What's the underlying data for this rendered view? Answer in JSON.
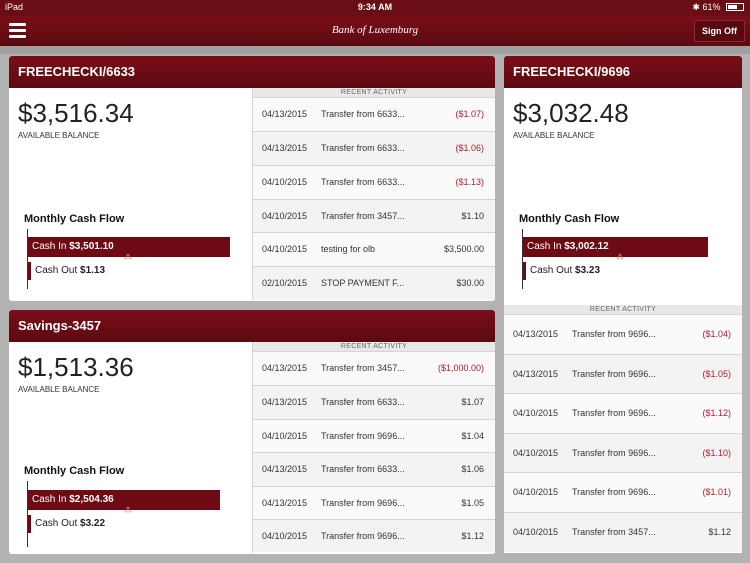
{
  "status": {
    "device": "iPad",
    "time": "9:34 AM",
    "battery": "61%"
  },
  "nav": {
    "brand": "Bank of Luxemburg",
    "signoff": "Sign Off"
  },
  "activity_header": "RECENT ACTIVITY",
  "accounts": [
    {
      "name": "FREECHECKI/6633",
      "balance": "$3,516.34",
      "balance_label": "AVAILABLE BALANCE",
      "cashflow_title": "Monthly Cash Flow",
      "cash_in_label": "Cash In",
      "cash_in": "$3,501.10",
      "cash_out_label": "Cash Out",
      "cash_out": "$1.13",
      "transactions": [
        {
          "date": "04/13/2015",
          "desc": "Transfer from 6633...",
          "amount": "($1.07)"
        },
        {
          "date": "04/13/2015",
          "desc": "Transfer from 6633...",
          "amount": "($1.06)"
        },
        {
          "date": "04/10/2015",
          "desc": "Transfer from 6633...",
          "amount": "($1.13)"
        },
        {
          "date": "04/10/2015",
          "desc": "Transfer from 3457...",
          "amount": "$1.10"
        },
        {
          "date": "04/10/2015",
          "desc": "testing for olb",
          "amount": "$3,500.00"
        },
        {
          "date": "02/10/2015",
          "desc": "STOP PAYMENT F...",
          "amount": "$30.00"
        }
      ]
    },
    {
      "name": "Savings-3457",
      "balance": "$1,513.36",
      "balance_label": "AVAILABLE BALANCE",
      "cashflow_title": "Monthly Cash Flow",
      "cash_in_label": "Cash In",
      "cash_in": "$2,504.36",
      "cash_out_label": "Cash Out",
      "cash_out": "$3.22",
      "transactions": [
        {
          "date": "04/13/2015",
          "desc": "Transfer from 3457...",
          "amount": "($1,000.00)"
        },
        {
          "date": "04/13/2015",
          "desc": "Transfer from 6633...",
          "amount": "$1.07"
        },
        {
          "date": "04/10/2015",
          "desc": "Transfer from 9696...",
          "amount": "$1.04"
        },
        {
          "date": "04/13/2015",
          "desc": "Transfer from 6633...",
          "amount": "$1.06"
        },
        {
          "date": "04/13/2015",
          "desc": "Transfer from 9696...",
          "amount": "$1.05"
        },
        {
          "date": "04/10/2015",
          "desc": "Transfer from 9696...",
          "amount": "$1.12"
        }
      ]
    },
    {
      "name": "FREECHECKI/9696",
      "balance": "$3,032.48",
      "balance_label": "AVAILABLE BALANCE",
      "cashflow_title": "Monthly Cash Flow",
      "cash_in_label": "Cash In",
      "cash_in": "$3,002.12",
      "cash_out_label": "Cash Out",
      "cash_out": "$3.23",
      "transactions": [
        {
          "date": "04/13/2015",
          "desc": "Transfer from 9696...",
          "amount": "($1.04)"
        },
        {
          "date": "04/13/2015",
          "desc": "Transfer from 9696...",
          "amount": "($1.05)"
        },
        {
          "date": "04/10/2015",
          "desc": "Transfer from 9696...",
          "amount": "($1.12)"
        },
        {
          "date": "04/10/2015",
          "desc": "Transfer from 9696...",
          "amount": "($1.10)"
        },
        {
          "date": "04/10/2015",
          "desc": "Transfer from 9696...",
          "amount": "($1.01)"
        },
        {
          "date": "04/10/2015",
          "desc": "Transfer from 3457...",
          "amount": "$1.12"
        }
      ]
    }
  ]
}
